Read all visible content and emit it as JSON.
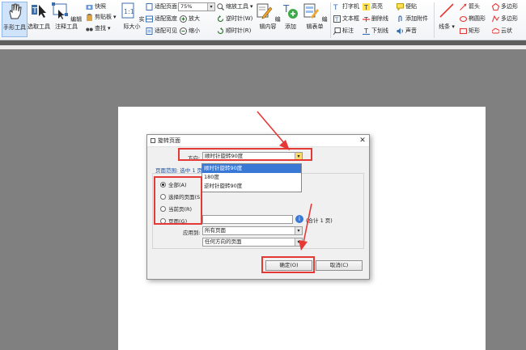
{
  "ribbon": {
    "hand_tool": "手形工具",
    "select_tool": "选取工具",
    "edit_annotation_tool": "编辑注释工具",
    "snapshot": "快照",
    "clipboard": "剪贴板",
    "find": "查找",
    "actual_size": "实际大小",
    "fit_page": "适配页面",
    "fit_width": "适配宽度",
    "fit_visible": "适配可见",
    "zoom_value": "75%",
    "zoom_tool": "缩放工具",
    "zoom_in": "放大",
    "zoom_out": "缩小",
    "rotate_ccw": "逆时针(W)",
    "rotate_cw": "顺时针(R)",
    "edit_content": "编辑内容",
    "add": "添加",
    "edit_form": "编辑表单",
    "typewriter": "打字机",
    "textbox": "文本框",
    "callout": "标注",
    "highlight": "高亮",
    "strikeout": "删除线",
    "underline": "下划线",
    "note": "便贴",
    "attach_file": "添加附件",
    "sound": "声音",
    "line": "线条",
    "arrow": "箭头",
    "ellipse": "椭圆形",
    "rectangle": "矩形",
    "polygon": "多边形",
    "polyline": "多边形",
    "cloud": "云状"
  },
  "dialog": {
    "title": "旋转页面",
    "direction_label": "方向:",
    "direction_value": "顺时针旋转90度",
    "direction_options": [
      "顺时针旋转90度",
      "180度",
      "逆时针旋转90度"
    ],
    "page_range_label": "页面范围: 选中 1 页",
    "range_all": "全部(A)",
    "range_selected": "选择的页面(S)",
    "range_current": "当前页(R)",
    "range_pages": "页面(G)",
    "total_pages": "(合计 1 页)",
    "apply_to_label": "应用到:",
    "apply_to_value": "所有页面",
    "orientation_value": "任何方向的页面",
    "ok": "确定(O)",
    "cancel": "取消(C)"
  }
}
